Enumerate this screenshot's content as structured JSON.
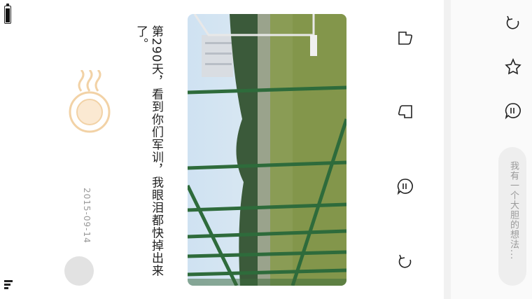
{
  "post": {
    "text": "第290天，看到你们军训，我眼泪都快掉出来了。",
    "date": "2015-09-14"
  },
  "actions": [
    {
      "name": "like",
      "icon": "thumb-up-icon"
    },
    {
      "name": "dislike",
      "icon": "thumb-down-icon"
    },
    {
      "name": "comment",
      "icon": "comment-icon"
    },
    {
      "name": "share",
      "icon": "share-icon"
    }
  ],
  "sidebar": {
    "icons": [
      "share-icon",
      "star-icon",
      "comment-icon"
    ],
    "comment_placeholder": "我有一个大胆的想法..."
  },
  "status": {
    "battery_level": 0.85
  }
}
